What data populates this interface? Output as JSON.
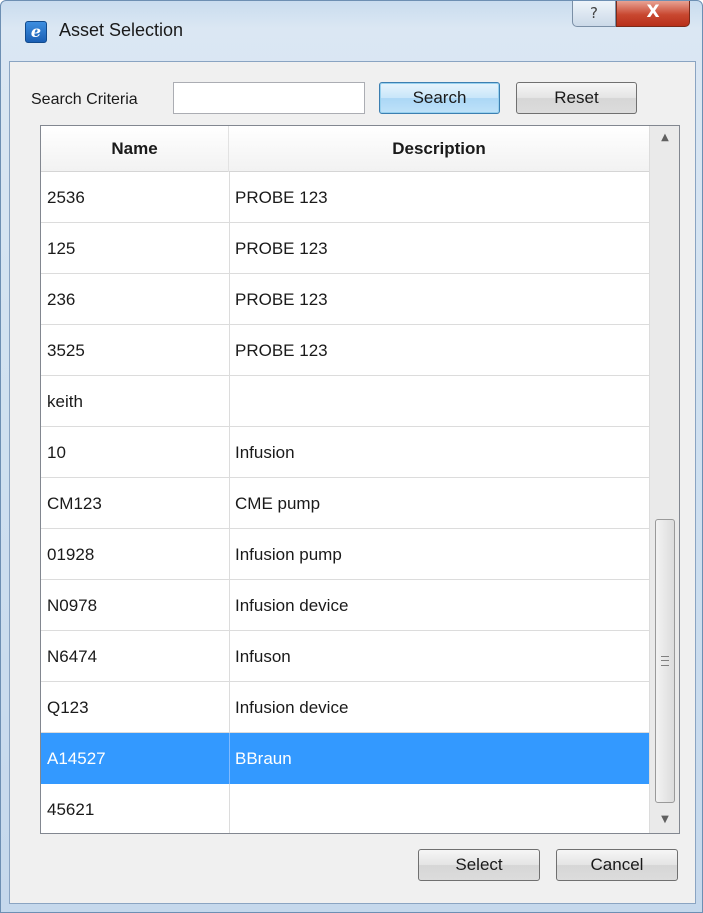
{
  "window": {
    "title": "Asset Selection",
    "help_label": "?",
    "close_label": "X",
    "app_icon_glyph": "e"
  },
  "search": {
    "label": "Search Criteria",
    "value": "",
    "placeholder": "",
    "search_button": "Search",
    "reset_button": "Reset"
  },
  "table": {
    "columns": [
      "Name",
      "Description"
    ],
    "rows": [
      {
        "name": "2536",
        "description": "PROBE 123"
      },
      {
        "name": "125",
        "description": "PROBE 123"
      },
      {
        "name": "236",
        "description": "PROBE 123"
      },
      {
        "name": "3525",
        "description": "PROBE 123"
      },
      {
        "name": "keith",
        "description": ""
      },
      {
        "name": "10",
        "description": "Infusion"
      },
      {
        "name": "CM123",
        "description": "CME pump"
      },
      {
        "name": "01928",
        "description": "Infusion pump"
      },
      {
        "name": "N0978",
        "description": "Infusion device"
      },
      {
        "name": "N6474",
        "description": "Infuson"
      },
      {
        "name": "Q123",
        "description": "Infusion device"
      },
      {
        "name": "A14527",
        "description": "BBraun"
      },
      {
        "name": "45621",
        "description": ""
      }
    ],
    "selected_row": 11
  },
  "footer": {
    "select_button": "Select",
    "cancel_button": "Cancel"
  },
  "colors": {
    "selection": "#3399ff",
    "close_button": "#c84730",
    "default_button": "#abd7f6"
  }
}
